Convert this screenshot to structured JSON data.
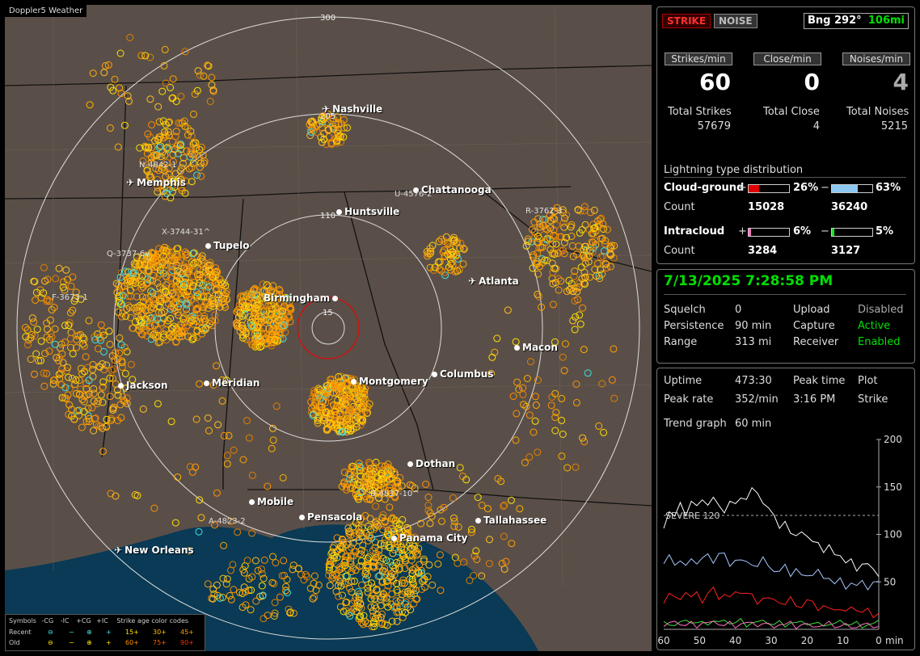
{
  "app_title": "Doppler5 Weather",
  "ring_labels": [
    "300",
    "205",
    "110",
    "15"
  ],
  "cities": [
    {
      "name": "Nashville",
      "icon": "plane-icon"
    },
    {
      "name": "Memphis",
      "icon": "plane-icon"
    },
    {
      "name": "Chattanooga",
      "icon": "dot"
    },
    {
      "name": "Huntsville",
      "icon": "dot"
    },
    {
      "name": "Tupelo",
      "icon": "dot"
    },
    {
      "name": "Birmingham",
      "icon": "dot"
    },
    {
      "name": "Atlanta",
      "icon": "plane-icon"
    },
    {
      "name": "Macon",
      "icon": "dot"
    },
    {
      "name": "Jackson",
      "icon": "dot"
    },
    {
      "name": "Meridian",
      "icon": "dot"
    },
    {
      "name": "Montgomery",
      "icon": "dot"
    },
    {
      "name": "Columbus",
      "icon": "dot"
    },
    {
      "name": "Dothan",
      "icon": "dot"
    },
    {
      "name": "Mobile",
      "icon": "dot"
    },
    {
      "name": "Pensacola",
      "icon": "dot"
    },
    {
      "name": "Tallahassee",
      "icon": "dot"
    },
    {
      "name": "Panama City",
      "icon": "dot"
    },
    {
      "name": "New Orleans",
      "icon": "plane-icon"
    }
  ],
  "storm_labels": [
    "N-4842-1",
    "U-4576-2",
    "R-3762-3",
    "X-3744-31^",
    "Q-3737-6v",
    "F-3673-1",
    "A-4823-2",
    "B-4837-10^"
  ],
  "legend": {
    "header": [
      "Symbols",
      "-CG",
      "-IC",
      "+CG",
      "+IC",
      "Strike age color codes"
    ],
    "recent_label": "Recent",
    "old_label": "Old",
    "recent_ages": [
      "15+",
      "30+",
      "45+"
    ],
    "old_ages": [
      "60+",
      "75+",
      "90+"
    ]
  },
  "top": {
    "strike_btn": "STRIKE",
    "noise_btn": "NOISE",
    "bearing": "Bng 292°",
    "distance": "106mi",
    "headers": [
      "Strikes/min",
      "Close/min",
      "Noises/min"
    ],
    "values": [
      "60",
      "0",
      "4"
    ],
    "totals_labels": [
      "Total Strikes",
      "Total Close",
      "Total Noises"
    ],
    "totals_values": [
      "57679",
      "4",
      "5215"
    ],
    "dist_title": "Lightning type distribution",
    "cg_label": "Cloud-ground",
    "ic_label": "Intracloud",
    "count_label": "Count",
    "plus": "+",
    "minus": "−",
    "cg_pos_pct": "26%",
    "cg_neg_pct": "63%",
    "cg_pos_count": "15028",
    "cg_neg_count": "36240",
    "ic_pos_pct": "6%",
    "ic_neg_pct": "5%",
    "ic_pos_count": "3284",
    "ic_neg_count": "3127",
    "cg_pos_frac": 0.26,
    "cg_neg_frac": 0.63,
    "ic_pos_frac": 0.06,
    "ic_neg_frac": 0.05
  },
  "status": {
    "datetime": "7/13/2025 7:28:58 PM",
    "rows": [
      [
        "Squelch",
        "0",
        "Upload",
        "Disabled"
      ],
      [
        "Persistence",
        "90 min",
        "Capture",
        "Active"
      ],
      [
        "Range",
        "313 mi",
        "Receiver",
        "Enabled"
      ]
    ]
  },
  "stats": {
    "uptime_label": "Uptime",
    "uptime": "473:30",
    "peak_time_label": "Peak time",
    "plot_label": "Plot",
    "peak_rate_label": "Peak rate",
    "peak_rate": "352/min",
    "peak_time": "3:16 PM",
    "plot": "Strike",
    "trend_label": "Trend graph",
    "trend": "60 min"
  },
  "chart_data": {
    "type": "line",
    "xlabel": "min",
    "x_ticks": [
      "60",
      "50",
      "40",
      "30",
      "20",
      "10",
      "0"
    ],
    "y_ticks": [
      "200",
      "150",
      "100",
      "50"
    ],
    "ylim": [
      0,
      200
    ],
    "severe_label": "SEVERE 120",
    "severe_value": 120,
    "series": [
      {
        "color": "#ffffff",
        "values": [
          110,
          125,
          118,
          130,
          122,
          135,
          128,
          140,
          132,
          138,
          127,
          125,
          135,
          130,
          142,
          138,
          148,
          140,
          135,
          128,
          118,
          110,
          115,
          100,
          95,
          105,
          98,
          90,
          95,
          82,
          88,
          75,
          80,
          70,
          72,
          65,
          70,
          68,
          60,
          58
        ]
      },
      {
        "color": "#a8c8ff",
        "values": [
          68,
          75,
          70,
          72,
          65,
          78,
          70,
          74,
          76,
          72,
          80,
          78,
          70,
          74,
          72,
          68,
          70,
          66,
          74,
          70,
          62,
          60,
          65,
          58,
          64,
          55,
          60,
          58,
          62,
          50,
          56,
          48,
          52,
          46,
          50,
          45,
          48,
          44,
          50,
          48
        ]
      },
      {
        "color": "#ff2020",
        "values": [
          30,
          38,
          32,
          35,
          40,
          33,
          36,
          30,
          38,
          42,
          35,
          38,
          33,
          36,
          40,
          38,
          35,
          30,
          34,
          32,
          28,
          30,
          26,
          32,
          28,
          24,
          30,
          26,
          22,
          25,
          20,
          24,
          22,
          18,
          20,
          22,
          18,
          20,
          16,
          18
        ]
      },
      {
        "color": "#40e040",
        "values": [
          6,
          8,
          5,
          7,
          6,
          9,
          7,
          6,
          8,
          10,
          7,
          6,
          8,
          7,
          9,
          6,
          8,
          7,
          6,
          8,
          5,
          7,
          6,
          8,
          6,
          5,
          7,
          6,
          5,
          7,
          6,
          5,
          6,
          7,
          5,
          6,
          5,
          6,
          5,
          6
        ]
      },
      {
        "color": "#ff70c0",
        "values": [
          4,
          6,
          5,
          7,
          4,
          6,
          5,
          8,
          6,
          5,
          7,
          4,
          6,
          5,
          7,
          6,
          4,
          5,
          6,
          4,
          5,
          6,
          4,
          5,
          3,
          5,
          4,
          6,
          4,
          3,
          5,
          4,
          3,
          4,
          5,
          3,
          4,
          3,
          4,
          3
        ]
      }
    ]
  },
  "colors": {
    "map_bg": "#5a4f48",
    "water": "#0a3a55",
    "strike_orange": "#ffa000",
    "strike_yellow": "#ffe000",
    "green_text": "#00e000",
    "strike_btn_red": "#ff3030"
  }
}
